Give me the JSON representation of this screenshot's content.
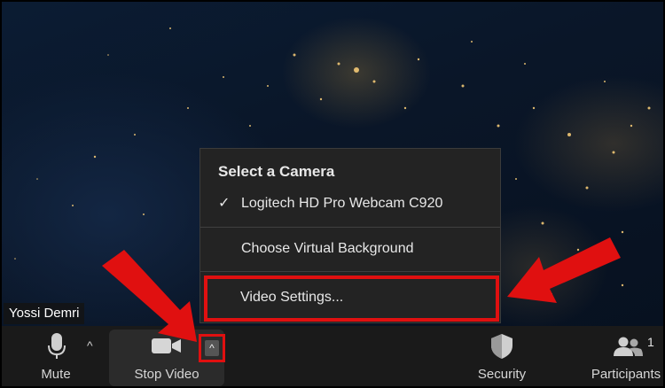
{
  "participant": {
    "name": "Yossi Demri"
  },
  "camera_menu": {
    "header": "Select a Camera",
    "selected_camera": "Logitech HD Pro Webcam C920",
    "virtual_background": "Choose Virtual Background",
    "video_settings": "Video Settings..."
  },
  "toolbar": {
    "mute_label": "Mute",
    "stop_video_label": "Stop Video",
    "security_label": "Security",
    "participants_label": "Participants",
    "participants_count": "1",
    "caret": "^"
  },
  "icons": {
    "mic": "microphone-icon",
    "video": "video-camera-icon",
    "shield": "shield-icon",
    "participants": "participants-icon",
    "check": "checkmark-icon"
  },
  "colors": {
    "highlight": "#e01010",
    "toolbar": "#1a1a1a",
    "menu": "#232323"
  }
}
